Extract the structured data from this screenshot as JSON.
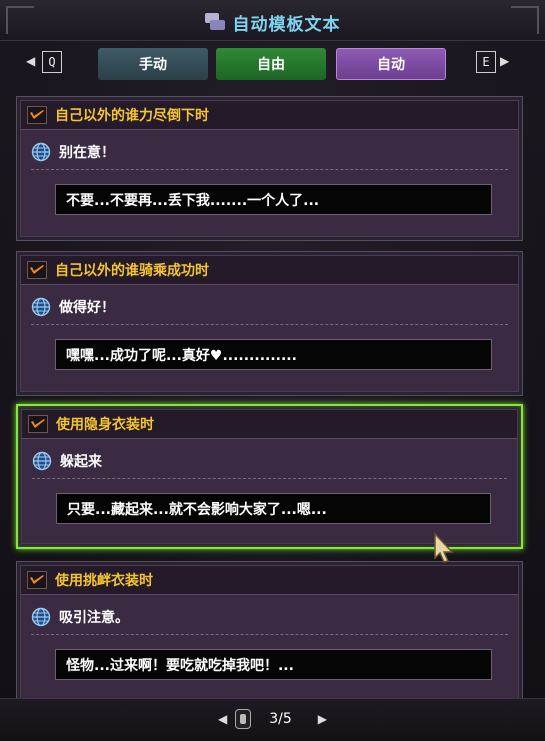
{
  "header": {
    "title": "自动模板文本",
    "icon": "chat-template-icon"
  },
  "tabs": {
    "left_key": "Q",
    "right_key": "E",
    "items": [
      {
        "label": "手动",
        "color": "#3e5a66"
      },
      {
        "label": "自由",
        "color": "#2f8a35"
      },
      {
        "label": "自动",
        "color": "#8f5ab5",
        "active": true
      }
    ]
  },
  "cards": [
    {
      "trigger": "自己以外的谁力尽倒下时",
      "phrase": "别在意！",
      "message": "不要...不要再...丢下我.......一个人了..."
    },
    {
      "trigger": "自己以外的谁骑乘成功时",
      "phrase": "做得好！",
      "message": "嘿嘿...成功了呢...真好♥.............."
    },
    {
      "trigger": "使用隐身衣装时",
      "phrase": "躲起来",
      "message": "只要...藏起来...就不会影响大家了...嗯...",
      "selected": true
    },
    {
      "trigger": "使用挑衅衣装时",
      "phrase": "吸引注意。",
      "message": "怪物...过来啊！要吃就吃掉我吧！..."
    }
  ],
  "pager": {
    "current": "3",
    "total": "5"
  },
  "colors": {
    "trigger": "#f4c430",
    "selected_border": "#8be43a",
    "title": "#7fd3ef"
  }
}
